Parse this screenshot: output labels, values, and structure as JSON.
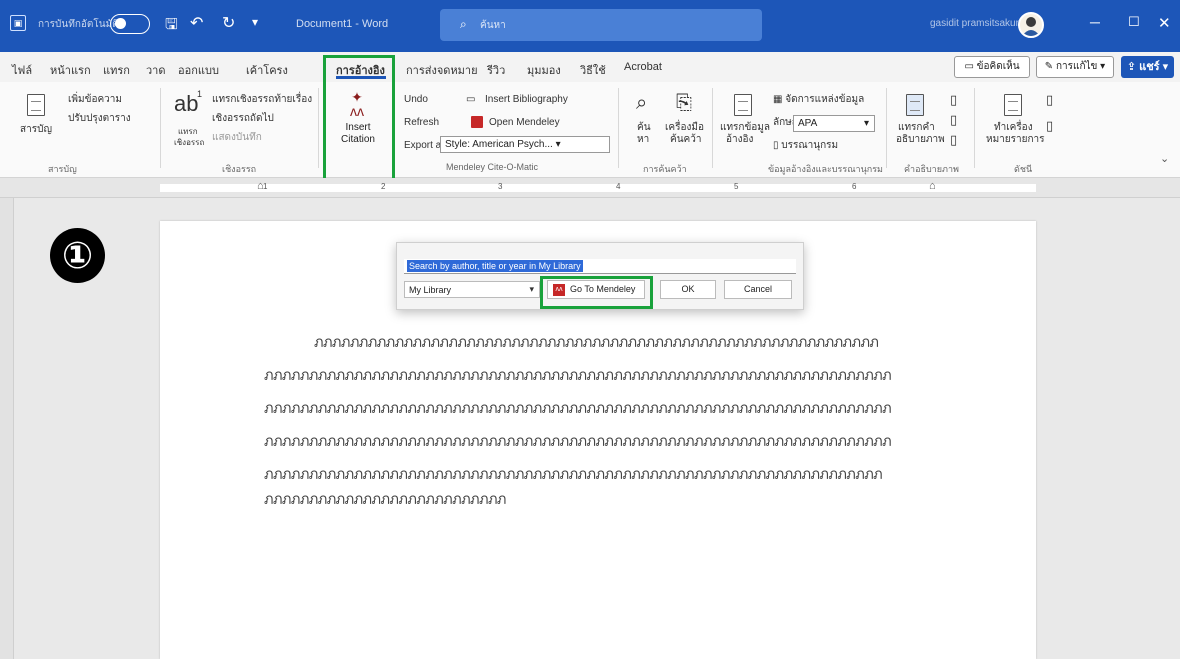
{
  "titlebar": {
    "app_icon": "word-save-icon",
    "autosave_label": "การบันทึกอัตโนมัติ",
    "document_title": "Document1 - Word",
    "search_placeholder": "ค้นหา",
    "user_name": "gasidit pramsitsakunn",
    "minimize": "─",
    "maximize": "☐",
    "close": "✕"
  },
  "tabs": [
    "ไฟล์",
    "หน้าแรก",
    "แทรก",
    "วาด",
    "ออกแบบ",
    "เค้าโครง",
    "การอ้างอิง",
    "การส่งจดหมาย",
    "รีวิว",
    "มุมมอง",
    "วิธีใช้",
    "Acrobat"
  ],
  "active_tab": "การอ้างอิง",
  "actions": {
    "comments": "ข้อคิดเห็น",
    "editing": "การแก้ไข",
    "share": "แชร์"
  },
  "ribbon": {
    "toc": {
      "label": "สารบัญ",
      "add_text": "เพิ่มข้อความ",
      "update_table": "ปรับปรุงตาราง",
      "group": "สารบัญ"
    },
    "footnotes": {
      "big_label": "ab",
      "superscript": "1",
      "insert_label_1": "แทรก",
      "insert_label_2": "เชิงอรรถ",
      "insert_endnote": "แทรกเชิงอรรถท้ายเรื่อง",
      "next_footnote": "เชิงอรรถถัดไป",
      "show_notes": "แสดงบันทึก",
      "group": "เชิงอรรถ"
    },
    "mendeley": {
      "insert_citation": "Insert Citation",
      "undo": "Undo",
      "refresh": "Refresh",
      "export_as": "Export as",
      "insert_bibliography": "Insert Bibliography",
      "open_mendeley": "Open Mendeley",
      "style_label": "Style:",
      "style_value": "American Psych...",
      "group": "Mendeley Cite-O-Matic"
    },
    "research": {
      "search_1": "ค้น",
      "search_2": "หา",
      "researcher_1": "เครื่องมือ",
      "researcher_2": "ค้นคว้า",
      "group": "การค้นคว้า"
    },
    "citations": {
      "insert_1": "แทรกข้อมูล",
      "insert_2": "อ้างอิง",
      "manage_sources": "จัดการแหล่งข้อมูล",
      "style_label": "ลักษณะ",
      "style_value": "APA",
      "bibliography": "บรรณานุกรม",
      "group": "ข้อมูลอ้างอิงและบรรณานุกรม"
    },
    "captions": {
      "insert_1": "แทรกคำ",
      "insert_2": "อธิบายภาพ",
      "group": "คำอธิบายภาพ"
    },
    "index": {
      "mark_1": "ทำเครื่อง",
      "mark_2": "หมายรายการ",
      "group": "ดัชนี"
    }
  },
  "ruler_marks": [
    "1",
    "2",
    "3",
    "4",
    "5",
    "6"
  ],
  "step_badge": "①",
  "dialog": {
    "search_placeholder": "Search by author, title or year in My Library",
    "library_select": "My Library",
    "go_to_mendeley": "Go To Mendeley",
    "ok": "OK",
    "cancel": "Cancel"
  },
  "document_lines": [
    "ภภภภภภภภภภภภภภภภภภภภภภภภภภภภภภภภภภภภภภภภภภภภภภภภภภภภภภภภภภภภภภภ",
    "ภภภภภภภภภภภภภภภภภภภภภภภภภภภภภภภภภภภภภภภภภภภภภภภภภภภภภภภภภภภภภภภภภภภภภภ",
    "ภภภภภภภภภภภภภภภภภภภภภภภภภภภภภภภภภภภภภภภภภภภภภภภภภภภภภภภภภภภภภภภภภภภภภภ",
    "ภภภภภภภภภภภภภภภภภภภภภภภภภภภภภภภภภภภภภภภภภภภภภภภภภภภภภภภภภภภภภภภภภภภภภภ",
    "ภภภภภภภภภภภภภภภภภภภภภภภภภภภภภภภภภภภภภภภภภภภภภภภภภภภภภภภภภภภภภภภภภภภภภ",
    "ภภภภภภภภภภภภภภภภภภภภภภภภภภภ"
  ],
  "colors": {
    "titlebar": "#1d56b8",
    "highlight": "#19a23b",
    "mendeley_red": "#c62828"
  }
}
